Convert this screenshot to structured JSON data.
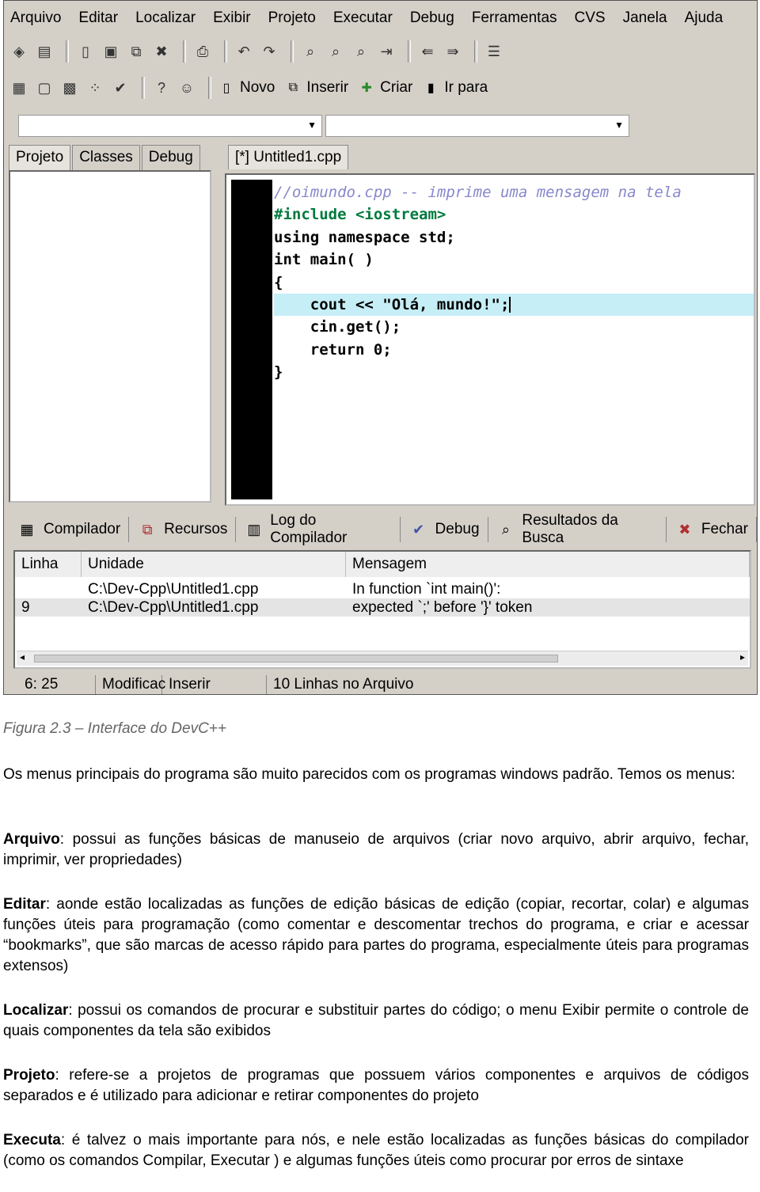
{
  "ide": {
    "menu": [
      "Arquivo",
      "Editar",
      "Localizar",
      "Exibir",
      "Projeto",
      "Executar",
      "Debug",
      "Ferramentas",
      "CVS",
      "Janela",
      "Ajuda"
    ],
    "toolbar2_buttons": {
      "novo": "Novo",
      "inserir": "Inserir",
      "criar": "Criar",
      "ir_para": "Ir para"
    },
    "left_tabs": [
      "Projeto",
      "Classes",
      "Debug"
    ],
    "editor_tab": "[*] Untitled1.cpp",
    "code": [
      "//oimundo.cpp -- imprime uma mensagem na tela",
      "#include <iostream>",
      "using namespace std;",
      "int main( )",
      "{",
      "    cout << \"Olá, mundo!\";",
      "    cin.get();",
      "    return 0;",
      "}"
    ],
    "bottom_tabs": [
      "Compilador",
      "Recursos",
      "Log do Compilador",
      "Debug",
      "Resultados da Busca",
      "Fechar"
    ],
    "table": {
      "headers": [
        "Linha",
        "Unidade",
        "Mensagem"
      ],
      "rows": [
        [
          "",
          "C:\\Dev-Cpp\\Untitled1.cpp",
          "In function `int main()':"
        ],
        [
          "9",
          "C:\\Dev-Cpp\\Untitled1.cpp",
          "expected `;' before '}' token"
        ]
      ]
    },
    "status": {
      "pos": "6: 25",
      "mod": "Modificac",
      "ins": "Inserir",
      "lines": "10 Linhas no Arquivo"
    }
  },
  "caption": "Figura 2.3 – Interface do DevC++",
  "paragraphs": {
    "intro": "Os menus principais do programa são muito parecidos com os programas windows padrão. Temos os menus:",
    "arquivo_term": "Arquivo",
    "arquivo_text": ": possui as funções básicas de manuseio de arquivos (criar novo arquivo, abrir arquivo, fechar, imprimir, ver propriedades)",
    "editar_term": "Editar",
    "editar_text": ": aonde estão localizadas as funções de edição básicas de edição (copiar, recortar, colar) e algumas funções úteis para programação (como comentar e descomentar trechos do programa, e criar e acessar “bookmarks”, que são marcas de acesso rápido para partes do programa, especialmente úteis para programas extensos)",
    "localizar_term": "Localizar",
    "localizar_text": ": possui os comandos de procurar e substituir partes do código; o menu Exibir permite o controle de quais componentes da tela são exibidos",
    "projeto_term": "Projeto",
    "projeto_text": ": refere-se a projetos de programas que possuem vários componentes e arquivos de códigos separados e é utilizado para adicionar e retirar componentes do projeto",
    "executa_term": "Executa",
    "executa_text": ": é talvez o mais importante para nós, e nele estão localizadas as funções básicas do compilador (como os comandos Compilar, Executar ) e algumas funções úteis como procurar por erros de sintaxe"
  }
}
